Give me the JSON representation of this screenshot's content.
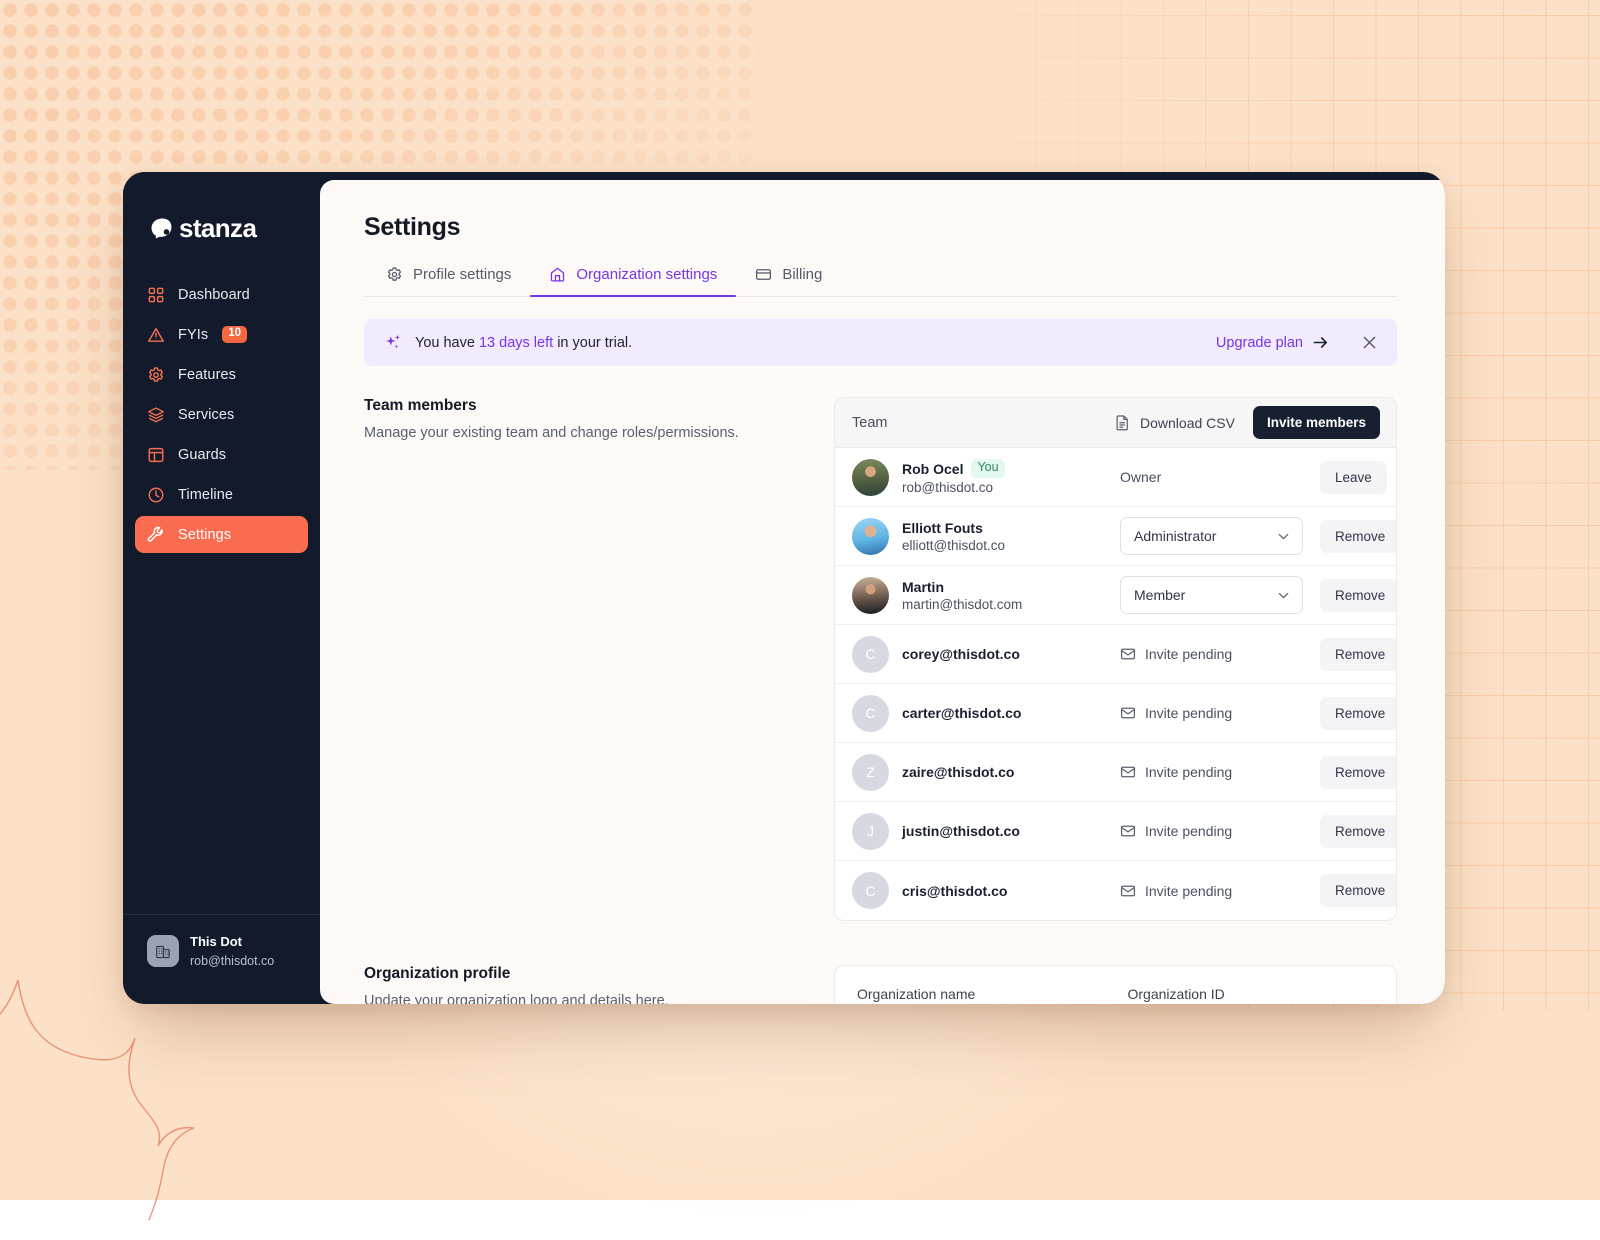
{
  "app": {
    "brand": "stanza",
    "accent_coral": "#fa6c50",
    "accent_purple": "#7735e8",
    "sidebar_bg": "#131a2b"
  },
  "sidebar": {
    "items": [
      {
        "label": "Dashboard",
        "icon": "grid-icon",
        "badge": null,
        "active": false
      },
      {
        "label": "FYIs",
        "icon": "warning-triangle-icon",
        "badge": "10",
        "active": false
      },
      {
        "label": "Features",
        "icon": "gear-icon",
        "badge": null,
        "active": false
      },
      {
        "label": "Services",
        "icon": "layers-icon",
        "badge": null,
        "active": false
      },
      {
        "label": "Guards",
        "icon": "layout-panel-icon",
        "badge": null,
        "active": false
      },
      {
        "label": "Timeline",
        "icon": "clock-icon",
        "badge": null,
        "active": false
      },
      {
        "label": "Settings",
        "icon": "wrench-icon",
        "badge": null,
        "active": true
      }
    ],
    "footer": {
      "icon": "building-icon",
      "org_name": "This Dot",
      "email": "rob@thisdot.co"
    }
  },
  "header": {
    "title": "Settings"
  },
  "tabs": [
    {
      "label": "Profile settings",
      "icon": "gear-icon",
      "active": false
    },
    {
      "label": "Organization settings",
      "icon": "home-icon",
      "active": true
    },
    {
      "label": "Billing",
      "icon": "credit-card-icon",
      "active": false
    }
  ],
  "trial_banner": {
    "icon": "sparkle-icon",
    "text_before": "You have",
    "highlight": "13 days left",
    "text_after": "in your trial.",
    "upgrade_label": "Upgrade plan",
    "upgrade_arrow": "→",
    "close_icon": "close-icon"
  },
  "team_section": {
    "heading": "Team members",
    "description": "Manage your existing team and change roles/permissions.",
    "card_title": "Team",
    "download_csv_label": "Download CSV",
    "download_csv_icon": "document-icon",
    "invite_label": "Invite members",
    "members": [
      {
        "name": "Rob Ocel",
        "badge": "You",
        "email": "rob@thisdot.co",
        "avatar_type": "photo",
        "avatar_kind": "rob",
        "initial": "",
        "role_type": "plain",
        "role": "Owner",
        "action": "Leave"
      },
      {
        "name": "Elliott Fouts",
        "badge": null,
        "email": "elliott@thisdot.co",
        "avatar_type": "photo",
        "avatar_kind": "elliott",
        "initial": "",
        "role_type": "select",
        "role": "Administrator",
        "action": "Remove"
      },
      {
        "name": "Martin",
        "badge": null,
        "email": "martin@thisdot.com",
        "avatar_type": "photo",
        "avatar_kind": "martin",
        "initial": "",
        "role_type": "select",
        "role": "Member",
        "action": "Remove"
      },
      {
        "name": "",
        "badge": null,
        "email": "corey@thisdot.co",
        "avatar_type": "initial",
        "avatar_kind": "",
        "initial": "C",
        "role_type": "pending",
        "role": "Invite pending",
        "action": "Remove"
      },
      {
        "name": "",
        "badge": null,
        "email": "carter@thisdot.co",
        "avatar_type": "initial",
        "avatar_kind": "",
        "initial": "C",
        "role_type": "pending",
        "role": "Invite pending",
        "action": "Remove"
      },
      {
        "name": "",
        "badge": null,
        "email": "zaire@thisdot.co",
        "avatar_type": "initial",
        "avatar_kind": "",
        "initial": "Z",
        "role_type": "pending",
        "role": "Invite pending",
        "action": "Remove"
      },
      {
        "name": "",
        "badge": null,
        "email": "justin@thisdot.co",
        "avatar_type": "initial",
        "avatar_kind": "",
        "initial": "J",
        "role_type": "pending",
        "role": "Invite pending",
        "action": "Remove"
      },
      {
        "name": "",
        "badge": null,
        "email": "cris@thisdot.co",
        "avatar_type": "initial",
        "avatar_kind": "",
        "initial": "C",
        "role_type": "pending",
        "role": "Invite pending",
        "action": "Remove"
      }
    ]
  },
  "org_section": {
    "heading": "Organization profile",
    "description": "Update your organization logo and details here.",
    "fields": [
      {
        "label": "Organization name",
        "value": ""
      },
      {
        "label": "Organization ID",
        "value": ""
      }
    ]
  }
}
